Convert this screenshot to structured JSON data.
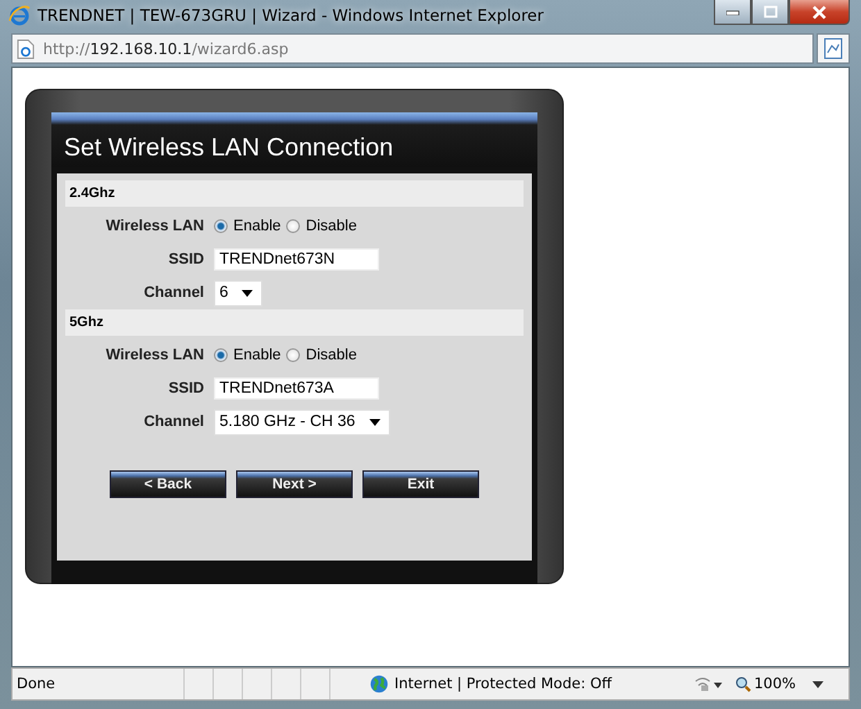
{
  "window": {
    "title": "TRENDNET | TEW-673GRU | Wizard - Windows Internet Explorer"
  },
  "address": {
    "scheme": "http://",
    "host": "192.168.10.1",
    "path": "/wizard6.asp"
  },
  "wizard": {
    "title": "Set Wireless LAN Connection",
    "sections": [
      {
        "title": "2.4Ghz",
        "rows": [
          {
            "kind": "radio",
            "label": "Wireless LAN",
            "options": [
              {
                "label": "Enable",
                "selected": true
              },
              {
                "label": "Disable",
                "selected": false
              }
            ]
          },
          {
            "kind": "text",
            "label": "SSID",
            "value": "TRENDnet673N"
          },
          {
            "kind": "select",
            "label": "Channel",
            "value": "6"
          }
        ]
      },
      {
        "title": "5Ghz",
        "rows": [
          {
            "kind": "radio",
            "label": "Wireless LAN",
            "options": [
              {
                "label": "Enable",
                "selected": true
              },
              {
                "label": "Disable",
                "selected": false
              }
            ]
          },
          {
            "kind": "text",
            "label": "SSID",
            "value": "TRENDnet673A"
          },
          {
            "kind": "select",
            "label": "Channel",
            "value": "5.180 GHz - CH 36"
          }
        ]
      }
    ],
    "buttons": [
      "< Back",
      "Next >",
      "Exit"
    ]
  },
  "status_bar": {
    "status": "Done",
    "zone": "Internet | Protected Mode: Off",
    "zoom": "100%"
  }
}
